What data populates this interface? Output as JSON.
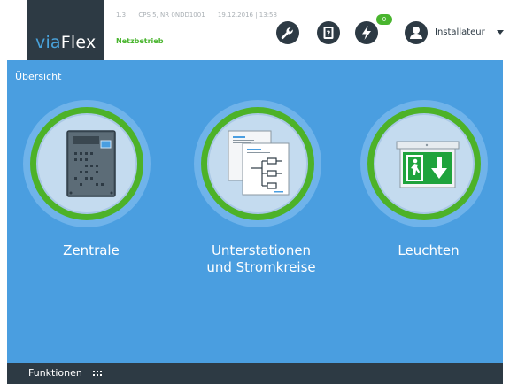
{
  "header": {
    "logo": {
      "prefix": "via",
      "suffix": "Flex"
    },
    "meta": {
      "field1": "1.3",
      "field2": "CPS 5, NR 0NDD1001",
      "field3": "19.12.2016 | 13:58"
    },
    "mode": "Netzbetrieb",
    "icons": [
      "wrench-icon",
      "log-book-icon",
      "lightning-icon",
      "user-icon"
    ],
    "badge_count": "0",
    "user_label": "Installateur"
  },
  "main": {
    "title": "Übersicht",
    "tiles": [
      {
        "label_line1": "Zentrale",
        "label_line2": ""
      },
      {
        "label_line1": "Unterstationen",
        "label_line2": "und Stromkreise"
      },
      {
        "label_line1": "Leuchten",
        "label_line2": ""
      }
    ]
  },
  "footer": {
    "label": "Funktionen"
  },
  "colors": {
    "brand_dark": "#2d3a44",
    "main_blue": "#4a9ee0",
    "status_green": "#49b52e",
    "ring_green": "#4db228"
  }
}
